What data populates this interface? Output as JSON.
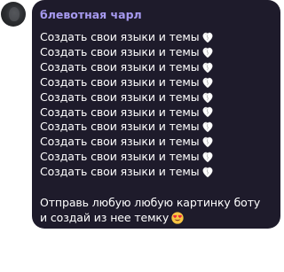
{
  "message": {
    "sender": "блевотная чарл",
    "lines": [
      "Создать свои языки и темы",
      "Создать свои языки и темы",
      "Создать свои языки и темы",
      "Создать свои языки и темы",
      "Создать свои языки и темы",
      "Создать свои языки и темы",
      "Создать свои языки и темы",
      "Создать свои языки и темы",
      "Создать свои языки и темы",
      "Создать свои языки и темы"
    ],
    "line_icon": "white-heart-emoji-icon",
    "footer_line1": "Отправь любую любую картинку боту",
    "footer_line2": "и создай из нее темку",
    "footer_icon": "heart-eyes-emoji-icon"
  },
  "colors": {
    "bubble_bg": "#1e1b2b",
    "sender_name": "#a79af0",
    "text": "#ffffff"
  }
}
